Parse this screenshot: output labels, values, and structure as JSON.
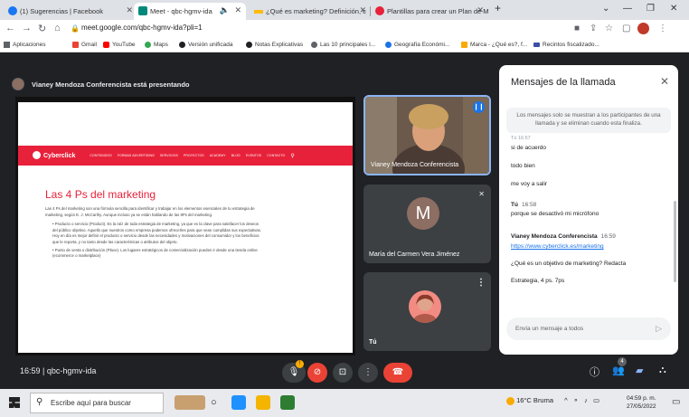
{
  "browser": {
    "tabs": [
      {
        "label": "(1) Sugerencias | Facebook",
        "favicon_color": "#1877f2"
      },
      {
        "label": "Meet - qbc-hgmv-ida",
        "favicon_color": "#00897b"
      },
      {
        "label": "¿Qué es marketing? Definición, c",
        "favicon_color": "#fbbc04"
      },
      {
        "label": "Plantillas para crear un Plan de M",
        "favicon_color": "#e8213a"
      }
    ],
    "new_tab": "+",
    "url": "meet.google.com/qbc-hgmv-ida?pli=1",
    "bookmarks": [
      {
        "label": "Aplicaciones",
        "color": "#5f6368"
      },
      {
        "label": "Gmail",
        "color": "#ea4335"
      },
      {
        "label": "YouTube",
        "color": "#ff0000"
      },
      {
        "label": "Maps",
        "color": "#34a853"
      },
      {
        "label": "Versión unificada",
        "color": "#202124"
      },
      {
        "label": "Notas Explicativas",
        "color": "#202124"
      },
      {
        "label": "Las 10 principales l...",
        "color": "#5f6368"
      },
      {
        "label": "Geografía Económi...",
        "color": "#1a73e8"
      },
      {
        "label": "Marca - ¿Qué es?, f...",
        "color": "#f9ab00"
      },
      {
        "label": "Recintos fiscalizado...",
        "color": "#3c4fa5"
      }
    ]
  },
  "meet": {
    "presenter_banner": "Vianey Mendoza Conferencista está presentando",
    "slide": {
      "brand": "Cyberclick",
      "nav": [
        "CONTENIDOS",
        "FORMAS ADVERTISING",
        "SERVICIOS",
        "PROYECTOS",
        "ACADEMY",
        "BLOG",
        "EVENTOS",
        "CONTACTO"
      ],
      "title": "Las 4 Ps del marketing",
      "paragraph": "Las 4 Ps del marketing son una fórmula sencilla para identificar y trabajar en los elementos esenciales de tu estrategia de marketing, según E. J. McCarthy. Aunque incluso ya se están hablando de las 8Ps del marketing.",
      "bullet1": "• Producto o servicio (Product). Es la raíz de toda estrategia de marketing, ya que es la clave para satisfacer los deseos del público objetivo. Aquello que nuestros como empresa podemos ofrecerles para que vean cumplidas sus expectativas. Hoy en día es mejor definir el producto o servicio desde las necesidades y motivaciones del consumidor y los beneficios que le reporta, y no tanto desde las características o atributos del objeto.",
      "bullet2": "• Punto de venta o distribución (Place). Los lugares estratégicos de comercialización pueden ir desde una tienda online (ecommerce o marketplace)"
    },
    "participants": [
      {
        "name": "Vianey Mendoza Conferencista"
      },
      {
        "name": "María del Carmen Vera Jiménez",
        "initial": "M"
      },
      {
        "name": "Tú"
      }
    ],
    "chat": {
      "title": "Mensajes de la llamada",
      "notice": "Los mensajes solo se muestran a los participantes de una llamada y se eliminan cuando esta finaliza.",
      "truncated_header": "Tú 16:57",
      "lines": [
        "si de acuerdo",
        "todo bien",
        "me voy a salir"
      ],
      "msg2_sender": "Tú",
      "msg2_time": "16:58",
      "msg2_text": "porque se desactivó mi micrófono",
      "msg3_sender": "Vianey Mendoza Conferencista",
      "msg3_time": "16:59",
      "msg3_link": "https://www.cyberclick.es/marketing",
      "msg3_text": "¿Qué es un objetivo de marketing? Redacta",
      "msg4_text": "Estrategia, 4 ps. 7ps",
      "input_placeholder": "Envía un mensaje a todos"
    },
    "controls": {
      "time_code": "16:59  |  qbc-hgmv-ida",
      "people_count": "4"
    }
  },
  "taskbar": {
    "search_placeholder": "Escribe aquí para buscar",
    "weather": "16°C  Bruma",
    "time": "04:59 p. m.",
    "date": "27/05/2022"
  }
}
